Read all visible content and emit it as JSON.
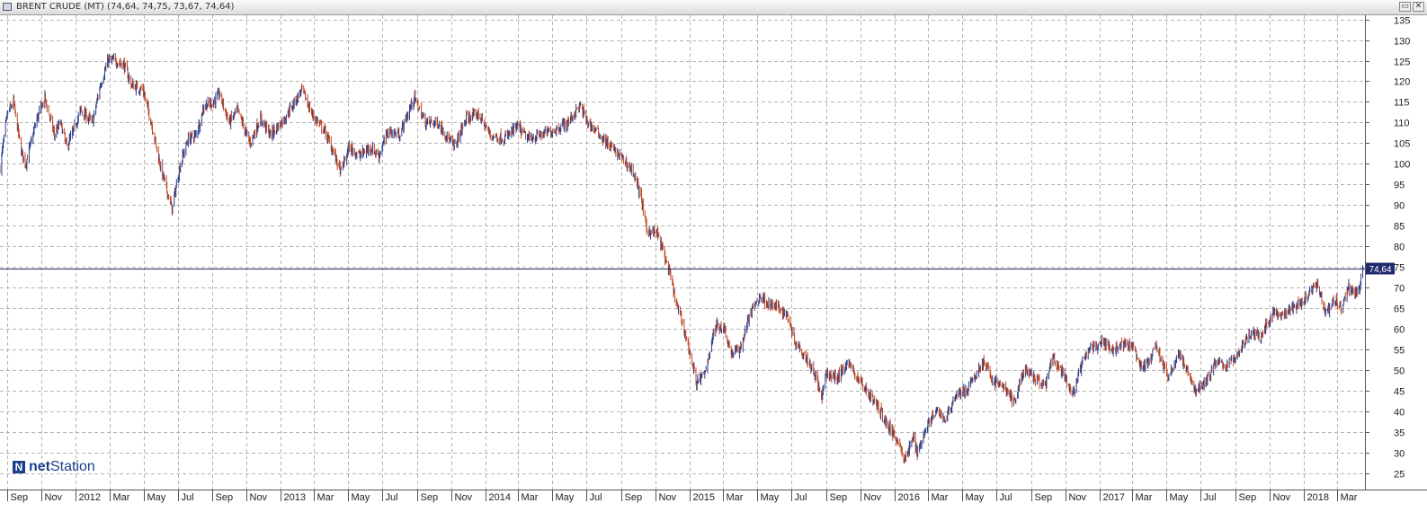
{
  "window": {
    "title": "BRENT CRUDE (MT) (74,64, 74,75, 73,67, 74,64)",
    "min_glyph": "▭",
    "close_glyph": "✕"
  },
  "logo": {
    "text_bold": "net",
    "text_rest": "Station",
    "icon": "netstation-logo-icon"
  },
  "chart_data": {
    "type": "candlestick",
    "ylim": [
      21,
      136
    ],
    "yticks": [
      25,
      30,
      35,
      40,
      45,
      50,
      55,
      60,
      65,
      70,
      75,
      80,
      85,
      90,
      95,
      100,
      105,
      110,
      115,
      120,
      125,
      130,
      135
    ],
    "xlim": [
      "2011-08-19",
      "2018-04-20"
    ],
    "xticks": [
      {
        "date": "2011-09-01",
        "label": "Sep"
      },
      {
        "date": "2011-11-01",
        "label": "Nov"
      },
      {
        "date": "2012-01-01",
        "label": "2012"
      },
      {
        "date": "2012-03-01",
        "label": "Mar"
      },
      {
        "date": "2012-05-01",
        "label": "May"
      },
      {
        "date": "2012-07-01",
        "label": "Jul"
      },
      {
        "date": "2012-09-01",
        "label": "Sep"
      },
      {
        "date": "2012-11-01",
        "label": "Nov"
      },
      {
        "date": "2013-01-01",
        "label": "2013"
      },
      {
        "date": "2013-03-01",
        "label": "Mar"
      },
      {
        "date": "2013-05-01",
        "label": "May"
      },
      {
        "date": "2013-07-01",
        "label": "Jul"
      },
      {
        "date": "2013-09-01",
        "label": "Sep"
      },
      {
        "date": "2013-11-01",
        "label": "Nov"
      },
      {
        "date": "2014-01-01",
        "label": "2014"
      },
      {
        "date": "2014-03-01",
        "label": "Mar"
      },
      {
        "date": "2014-05-01",
        "label": "May"
      },
      {
        "date": "2014-07-01",
        "label": "Jul"
      },
      {
        "date": "2014-09-01",
        "label": "Sep"
      },
      {
        "date": "2014-11-01",
        "label": "Nov"
      },
      {
        "date": "2015-01-01",
        "label": "2015"
      },
      {
        "date": "2015-03-01",
        "label": "Mar"
      },
      {
        "date": "2015-05-01",
        "label": "May"
      },
      {
        "date": "2015-07-01",
        "label": "Jul"
      },
      {
        "date": "2015-09-01",
        "label": "Sep"
      },
      {
        "date": "2015-11-01",
        "label": "Nov"
      },
      {
        "date": "2016-01-01",
        "label": "2016"
      },
      {
        "date": "2016-03-01",
        "label": "Mar"
      },
      {
        "date": "2016-05-01",
        "label": "May"
      },
      {
        "date": "2016-07-01",
        "label": "Jul"
      },
      {
        "date": "2016-09-01",
        "label": "Sep"
      },
      {
        "date": "2016-11-01",
        "label": "Nov"
      },
      {
        "date": "2017-01-01",
        "label": "2017"
      },
      {
        "date": "2017-03-01",
        "label": "Mar"
      },
      {
        "date": "2017-05-01",
        "label": "May"
      },
      {
        "date": "2017-07-01",
        "label": "Jul"
      },
      {
        "date": "2017-09-01",
        "label": "Sep"
      },
      {
        "date": "2017-11-01",
        "label": "Nov"
      },
      {
        "date": "2018-01-01",
        "label": "2018"
      },
      {
        "date": "2018-03-01",
        "label": "Mar"
      }
    ],
    "last_price": 74.64,
    "last_price_label": "74,64",
    "grid": true,
    "colors": {
      "up": "#2b3f8e",
      "down": "#c2461f",
      "last_line": "#1f2a5c",
      "grid": "#b4b4b4",
      "badge": "#1f2a6b"
    },
    "price_path": [
      [
        "2011-08-19",
        99
      ],
      [
        "2011-09-01",
        112
      ],
      [
        "2011-09-12",
        115
      ],
      [
        "2011-09-26",
        103
      ],
      [
        "2011-10-04",
        100
      ],
      [
        "2011-10-24",
        111
      ],
      [
        "2011-11-07",
        116
      ],
      [
        "2011-11-24",
        107
      ],
      [
        "2011-12-05",
        110
      ],
      [
        "2011-12-16",
        104
      ],
      [
        "2011-12-28",
        108
      ],
      [
        "2012-01-10",
        113
      ],
      [
        "2012-01-31",
        110
      ],
      [
        "2012-02-14",
        119
      ],
      [
        "2012-02-28",
        125
      ],
      [
        "2012-03-12",
        125
      ],
      [
        "2012-03-27",
        124
      ],
      [
        "2012-04-10",
        119
      ],
      [
        "2012-04-30",
        118
      ],
      [
        "2012-05-15",
        110
      ],
      [
        "2012-06-01",
        99
      ],
      [
        "2012-06-21",
        89
      ],
      [
        "2012-07-06",
        100
      ],
      [
        "2012-07-20",
        106
      ],
      [
        "2012-08-03",
        107
      ],
      [
        "2012-08-17",
        114
      ],
      [
        "2012-09-04",
        115
      ],
      [
        "2012-09-14",
        117
      ],
      [
        "2012-10-01",
        110
      ],
      [
        "2012-10-16",
        113
      ],
      [
        "2012-11-07",
        105
      ],
      [
        "2012-11-26",
        111
      ],
      [
        "2012-12-14",
        107
      ],
      [
        "2013-01-08",
        111
      ],
      [
        "2013-01-30",
        116
      ],
      [
        "2013-02-08",
        118
      ],
      [
        "2013-02-26",
        112
      ],
      [
        "2013-03-20",
        108
      ],
      [
        "2013-04-05",
        103
      ],
      [
        "2013-04-18",
        98
      ],
      [
        "2013-05-03",
        104
      ],
      [
        "2013-05-22",
        102
      ],
      [
        "2013-06-10",
        104
      ],
      [
        "2013-06-25",
        102
      ],
      [
        "2013-07-12",
        108
      ],
      [
        "2013-08-01",
        107
      ],
      [
        "2013-08-27",
        116
      ],
      [
        "2013-09-16",
        110
      ],
      [
        "2013-10-08",
        110
      ],
      [
        "2013-11-07",
        104
      ],
      [
        "2013-11-28",
        111
      ],
      [
        "2013-12-20",
        112
      ],
      [
        "2014-01-10",
        107
      ],
      [
        "2014-02-03",
        106
      ],
      [
        "2014-02-28",
        109
      ],
      [
        "2014-03-18",
        106
      ],
      [
        "2014-04-10",
        107
      ],
      [
        "2014-05-02",
        108
      ],
      [
        "2014-05-28",
        110
      ],
      [
        "2014-06-19",
        114
      ],
      [
        "2014-07-03",
        110
      ],
      [
        "2014-07-24",
        107
      ],
      [
        "2014-08-13",
        104
      ],
      [
        "2014-09-05",
        101
      ],
      [
        "2014-09-22",
        98
      ],
      [
        "2014-10-06",
        92
      ],
      [
        "2014-10-16",
        84
      ],
      [
        "2014-11-04",
        83
      ],
      [
        "2014-11-14",
        79
      ],
      [
        "2014-11-27",
        73
      ],
      [
        "2014-12-08",
        66
      ],
      [
        "2014-12-22",
        60
      ],
      [
        "2015-01-08",
        50
      ],
      [
        "2015-01-13",
        47
      ],
      [
        "2015-01-28",
        49
      ],
      [
        "2015-02-09",
        57
      ],
      [
        "2015-02-18",
        61
      ],
      [
        "2015-03-04",
        60
      ],
      [
        "2015-03-16",
        54
      ],
      [
        "2015-04-01",
        55
      ],
      [
        "2015-04-17",
        63
      ],
      [
        "2015-05-06",
        68
      ],
      [
        "2015-05-22",
        66
      ],
      [
        "2015-06-10",
        65
      ],
      [
        "2015-06-25",
        63
      ],
      [
        "2015-07-08",
        57
      ],
      [
        "2015-07-28",
        53
      ],
      [
        "2015-08-13",
        49
      ],
      [
        "2015-08-24",
        43
      ],
      [
        "2015-09-02",
        49
      ],
      [
        "2015-09-22",
        48
      ],
      [
        "2015-10-09",
        52
      ],
      [
        "2015-10-28",
        48
      ],
      [
        "2015-11-18",
        44
      ],
      [
        "2015-12-08",
        40
      ],
      [
        "2015-12-22",
        36
      ],
      [
        "2016-01-08",
        33
      ],
      [
        "2016-01-20",
        28
      ],
      [
        "2016-02-05",
        34
      ],
      [
        "2016-02-11",
        30
      ],
      [
        "2016-03-01",
        37
      ],
      [
        "2016-03-18",
        40
      ],
      [
        "2016-04-01",
        38
      ],
      [
        "2016-04-20",
        44
      ],
      [
        "2016-05-10",
        45
      ],
      [
        "2016-05-26",
        49
      ],
      [
        "2016-06-08",
        52
      ],
      [
        "2016-06-27",
        47
      ],
      [
        "2016-07-14",
        46
      ],
      [
        "2016-08-02",
        42
      ],
      [
        "2016-08-19",
        50
      ],
      [
        "2016-09-06",
        48
      ],
      [
        "2016-09-26",
        46
      ],
      [
        "2016-10-10",
        53
      ],
      [
        "2016-10-28",
        49
      ],
      [
        "2016-11-14",
        44
      ],
      [
        "2016-11-30",
        51
      ],
      [
        "2016-12-14",
        55
      ],
      [
        "2017-01-06",
        57
      ],
      [
        "2017-01-25",
        55
      ],
      [
        "2017-02-10",
        56
      ],
      [
        "2017-02-28",
        56
      ],
      [
        "2017-03-14",
        51
      ],
      [
        "2017-03-28",
        51
      ],
      [
        "2017-04-12",
        56
      ],
      [
        "2017-05-04",
        48
      ],
      [
        "2017-05-22",
        54
      ],
      [
        "2017-06-06",
        50
      ],
      [
        "2017-06-21",
        45
      ],
      [
        "2017-07-10",
        47
      ],
      [
        "2017-07-28",
        52
      ],
      [
        "2017-08-17",
        51
      ],
      [
        "2017-09-06",
        54
      ],
      [
        "2017-09-25",
        59
      ],
      [
        "2017-10-16",
        58
      ],
      [
        "2017-11-06",
        64
      ],
      [
        "2017-11-24",
        63
      ],
      [
        "2017-12-12",
        65
      ],
      [
        "2018-01-02",
        67
      ],
      [
        "2018-01-15",
        70
      ],
      [
        "2018-01-25",
        71
      ],
      [
        "2018-02-09",
        64
      ],
      [
        "2018-02-26",
        67
      ],
      [
        "2018-03-08",
        65
      ],
      [
        "2018-03-22",
        70
      ],
      [
        "2018-04-06",
        68
      ],
      [
        "2018-04-17",
        74.64
      ]
    ]
  }
}
